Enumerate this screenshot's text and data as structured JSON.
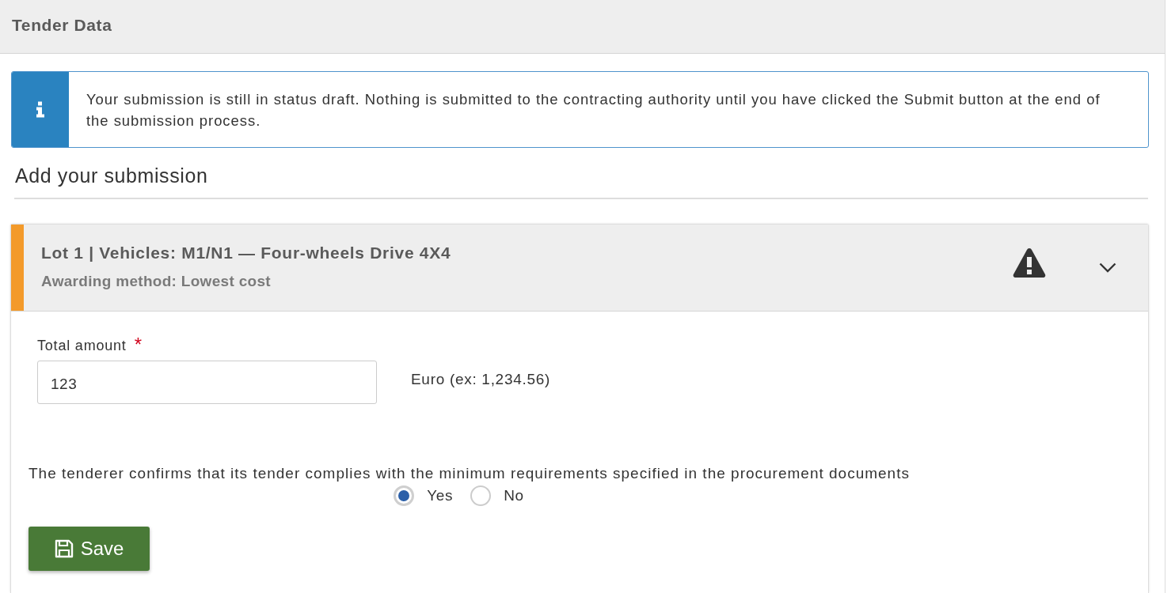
{
  "header": {
    "title": "Tender Data"
  },
  "info": {
    "message": "Your submission is still in status draft. Nothing is submitted to the contracting authority until you have clicked the Submit button at the end of the submission process."
  },
  "section": {
    "title": "Add your submission"
  },
  "lot": {
    "title": "Lot 1 | Vehicles: M1/N1 — Four-wheels Drive 4X4",
    "subtitle": "Awarding method: Lowest cost",
    "warning": true,
    "amount": {
      "label": "Total amount",
      "required_mark": "*",
      "value": "123",
      "unit": "Euro (ex: 1,234.56)"
    },
    "confirmation": {
      "question": "The tenderer confirms that its tender complies with the minimum requirements specified in the procurement documents",
      "options": [
        {
          "label": "Yes",
          "selected": true
        },
        {
          "label": "No",
          "selected": false
        }
      ]
    },
    "save_button": {
      "label": "Save"
    }
  }
}
